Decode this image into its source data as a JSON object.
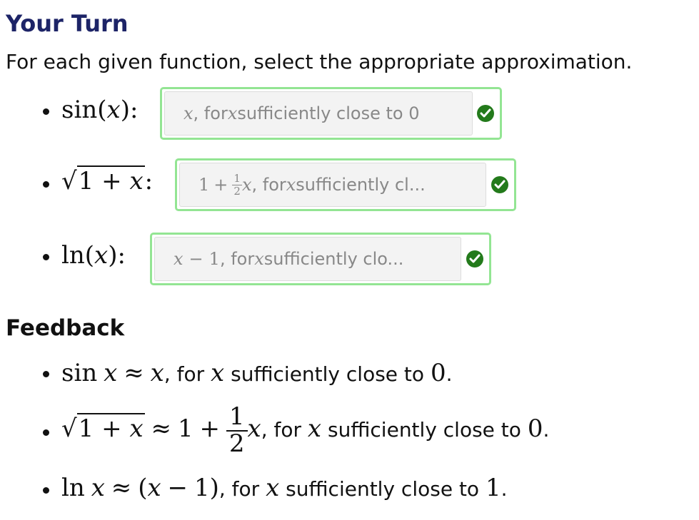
{
  "title": "Your Turn",
  "instructions": "For each given function, select the appropriate approximation.",
  "questions": [
    {
      "func_name": "sin",
      "func_arg": "x",
      "answer": {
        "var": "x",
        "text": ", for ",
        "var2": "x",
        "tail": " sufficiently close to 0"
      },
      "status_icon": "check-icon"
    },
    {
      "func_sqrt_1": "1",
      "func_sqrt_plus": "+",
      "func_sqrt_x": "x",
      "answer": {
        "lead": "1",
        "plus": "+",
        "frac_num": "1",
        "frac_den": "2",
        "var": "x",
        "text": ", for ",
        "var2": "x",
        "tail": " sufficiently cl..."
      },
      "status_icon": "check-icon"
    },
    {
      "func_name": "ln",
      "func_arg": "x",
      "answer": {
        "var": "x",
        "minus": "−",
        "one": "1",
        "text": ", for ",
        "var2": "x",
        "tail": " sufficiently clo..."
      },
      "status_icon": "check-icon"
    }
  ],
  "feedback_heading": "Feedback",
  "feedback": [
    {
      "lhs_fn": "sin",
      "lhs_var": "x",
      "approx": "≈",
      "rhs": "x",
      "text": ", for ",
      "var": "x",
      "tail": " sufficiently close to ",
      "point": "0",
      "end": "."
    },
    {
      "rad_1": "1",
      "rad_plus": "+",
      "rad_x": "x",
      "approx": "≈",
      "rhs_1": "1",
      "rhs_plus": "+",
      "frac_num": "1",
      "frac_den": "2",
      "rhs_x": "x",
      "text": ", for ",
      "var": "x",
      "tail": " sufficiently close to ",
      "point": "0",
      "end": "."
    },
    {
      "lhs_fn": "ln",
      "lhs_var": "x",
      "approx": "≈",
      "rhs_open": "(",
      "rhs_x": "x",
      "rhs_minus": "−",
      "rhs_1": "1",
      "rhs_close": ")",
      "text": ", for ",
      "var": "x",
      "tail": " sufficiently close to ",
      "point": "1",
      "end": "."
    }
  ],
  "colors": {
    "title": "#1d2467",
    "box_border": "#93e593",
    "check": "#237a1b"
  }
}
